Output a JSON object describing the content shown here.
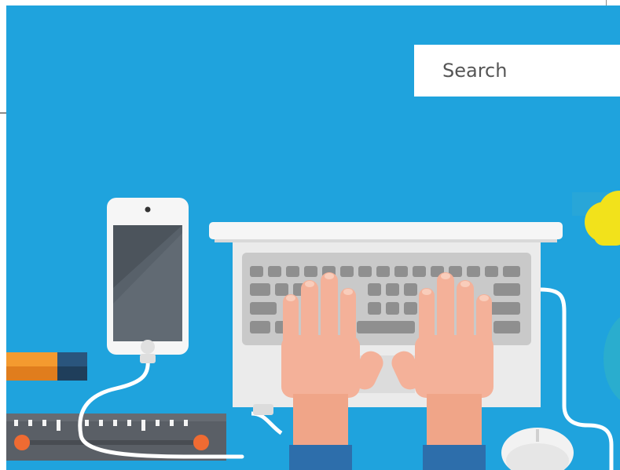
{
  "search": {
    "placeholder": "Search",
    "value": ""
  },
  "colors": {
    "background": "#1fa3dd",
    "laptop": "#eeeeee",
    "keys": "#8f8f8f",
    "skin": "#f4b199",
    "cloud": "#f2e21b",
    "sleeve": "#2d6eab",
    "phone_screen": "#58616a"
  },
  "icons": [
    "smartphone-icon",
    "laptop-icon",
    "keyboard-icon",
    "hands-icon",
    "mouse-icon",
    "cloud-icon",
    "pencil-icon",
    "ruler-icon"
  ]
}
